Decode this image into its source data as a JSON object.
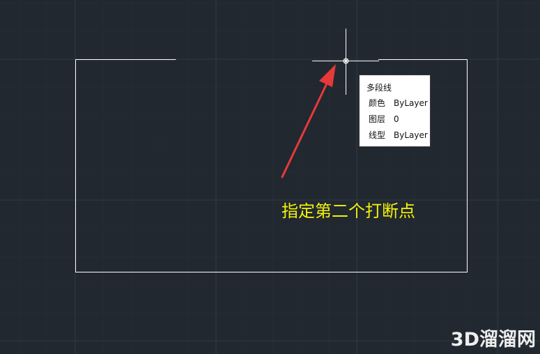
{
  "viewport": {
    "background_color": "#212830",
    "grid_color": "#2b333d"
  },
  "drawing": {
    "line_color": "#ffffff"
  },
  "cursor": {
    "style": "crosshair-with-pickbox"
  },
  "tooltip": {
    "title": "多段线",
    "rows": [
      {
        "key": "颜色",
        "value": "ByLayer"
      },
      {
        "key": "图层",
        "value": "0"
      },
      {
        "key": "线型",
        "value": "ByLayer"
      }
    ]
  },
  "annotation": {
    "instruction_text": "指定第二个打断点",
    "text_color": "#f2f20a",
    "arrow_color": "#e8393a",
    "arrow_icon": "red-arrow-icon"
  },
  "watermark": {
    "text": "3D溜溜网"
  }
}
